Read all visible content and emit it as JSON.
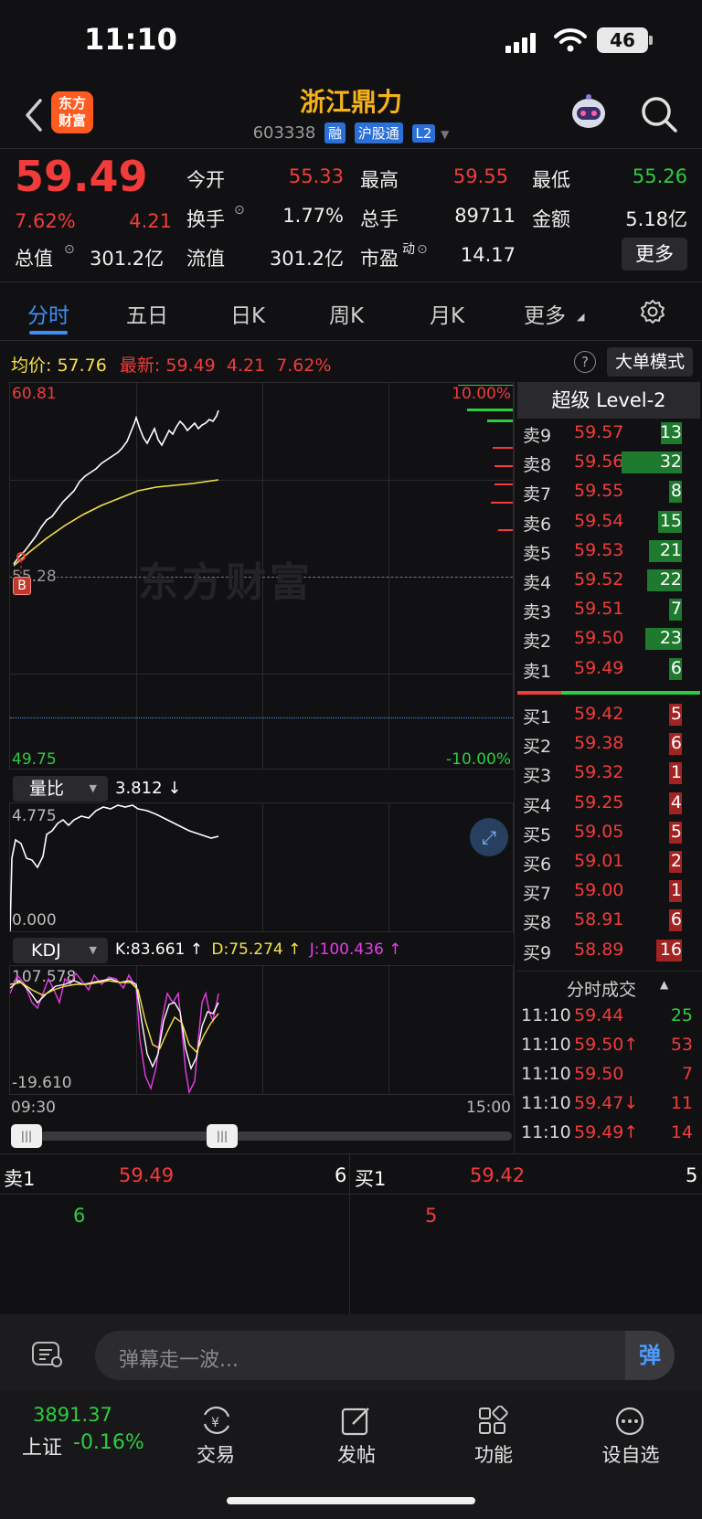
{
  "status_bar": {
    "time": "11:10",
    "battery": "46"
  },
  "header": {
    "logo_line1": "东方",
    "logo_line2": "财富",
    "stock_name": "浙江鼎力",
    "stock_code": "603338",
    "tags": [
      "融",
      "沪股通",
      "L2"
    ]
  },
  "quote": {
    "price": "59.49",
    "change_pct": "7.62%",
    "change": "4.21",
    "open_label": "今开",
    "open": "55.33",
    "high_label": "最高",
    "high": "59.55",
    "low_label": "最低",
    "low": "55.26",
    "turnover_label": "换手",
    "turnover": "1.77%",
    "volume_label": "总手",
    "volume": "89711",
    "amount_label": "金额",
    "amount": "5.18亿",
    "mcap_label": "总值",
    "mcap": "301.2亿",
    "float_label": "流值",
    "float_cap": "301.2亿",
    "pe_label": "市盈",
    "pe_sup": "动",
    "pe": "14.17",
    "more_button": "更多"
  },
  "tabs": [
    "分时",
    "五日",
    "日K",
    "周K",
    "月K",
    "更多"
  ],
  "chart_header": {
    "avg_label": "均价:",
    "avg_value": "57.76",
    "latest_label": "最新:",
    "latest_value": "59.49",
    "latest_change": "4.21",
    "latest_pct": "7.62%",
    "big_order_mode": "大单模式"
  },
  "intraday": {
    "y_top": "60.81",
    "y_bottom": "49.75",
    "y_ref": "55.28",
    "pct_top": "10.00%",
    "pct_bottom": "-10.00%",
    "watermark": "东方财富",
    "buy_marker": "B",
    "time_start": "09:30",
    "time_end": "15:00"
  },
  "volume_ratio": {
    "label": "量比",
    "value": "3.812 ↓",
    "y_top": "4.775",
    "y_bottom": "0.000"
  },
  "kdj": {
    "label": "KDJ",
    "k": "K:83.661 ↑",
    "d": "D:75.274 ↑",
    "j": "J:100.436 ↑",
    "y_top": "107.578",
    "y_bottom": "-19.610"
  },
  "level2": {
    "title": "超级 Level-2",
    "asks": [
      {
        "label": "卖9",
        "price": "59.57",
        "vol": "13",
        "level": 0.35
      },
      {
        "label": "卖8",
        "price": "59.56",
        "vol": "32",
        "level": 1.0
      },
      {
        "label": "卖7",
        "price": "59.55",
        "vol": "8",
        "level": 0.2
      },
      {
        "label": "卖6",
        "price": "59.54",
        "vol": "15",
        "level": 0.4
      },
      {
        "label": "卖5",
        "price": "59.53",
        "vol": "21",
        "level": 0.55
      },
      {
        "label": "卖4",
        "price": "59.52",
        "vol": "22",
        "level": 0.57
      },
      {
        "label": "卖3",
        "price": "59.51",
        "vol": "7",
        "level": 0.18
      },
      {
        "label": "卖2",
        "price": "59.50",
        "vol": "23",
        "level": 0.6
      },
      {
        "label": "卖1",
        "price": "59.49",
        "vol": "6",
        "level": 0.15
      }
    ],
    "bids": [
      {
        "label": "买1",
        "price": "59.42",
        "vol": "5",
        "level": 0.13
      },
      {
        "label": "买2",
        "price": "59.38",
        "vol": "6",
        "level": 0.15
      },
      {
        "label": "买3",
        "price": "59.32",
        "vol": "1",
        "level": 0.03
      },
      {
        "label": "买4",
        "price": "59.25",
        "vol": "4",
        "level": 0.11
      },
      {
        "label": "买5",
        "price": "59.05",
        "vol": "5",
        "level": 0.13
      },
      {
        "label": "买6",
        "price": "59.01",
        "vol": "2",
        "level": 0.06
      },
      {
        "label": "买7",
        "price": "59.00",
        "vol": "1",
        "level": 0.03
      },
      {
        "label": "买8",
        "price": "58.91",
        "vol": "6",
        "level": 0.15
      },
      {
        "label": "买9",
        "price": "58.89",
        "vol": "16",
        "level": 0.42
      }
    ]
  },
  "trades": {
    "title": "分时成交",
    "rows": [
      {
        "time": "11:10",
        "price": "59.44",
        "vol": "25",
        "color": "#2ecc40"
      },
      {
        "time": "11:10",
        "price": "59.50↑",
        "vol": "53",
        "color": "#f23b3b"
      },
      {
        "time": "11:10",
        "price": "59.50",
        "vol": "7",
        "color": "#f23b3b"
      },
      {
        "time": "11:10",
        "price": "59.47↓",
        "vol": "11",
        "color": "#f23b3b"
      },
      {
        "time": "11:10",
        "price": "59.49↑",
        "vol": "14",
        "color": "#f23b3b"
      }
    ]
  },
  "bottom_quote": {
    "ask_label": "卖1",
    "ask_price": "59.49",
    "ask_vol": "6",
    "ask_sub": "6",
    "bid_label": "买1",
    "bid_price": "59.42",
    "bid_vol": "5",
    "bid_sub": "5"
  },
  "comment": {
    "placeholder": "弹幕走一波...",
    "danmu": "弹"
  },
  "bottom_nav": {
    "index_value": "3891.37",
    "index_name": "上证",
    "index_change": "-0.16%",
    "items": [
      "交易",
      "发帖",
      "功能",
      "设自选"
    ]
  },
  "colors": {
    "up": "#f23b3b",
    "down": "#2ecc40",
    "avg_line": "#f5e04a",
    "accent": "#3e8ef7",
    "kdj_j": "#e83ce8"
  }
}
